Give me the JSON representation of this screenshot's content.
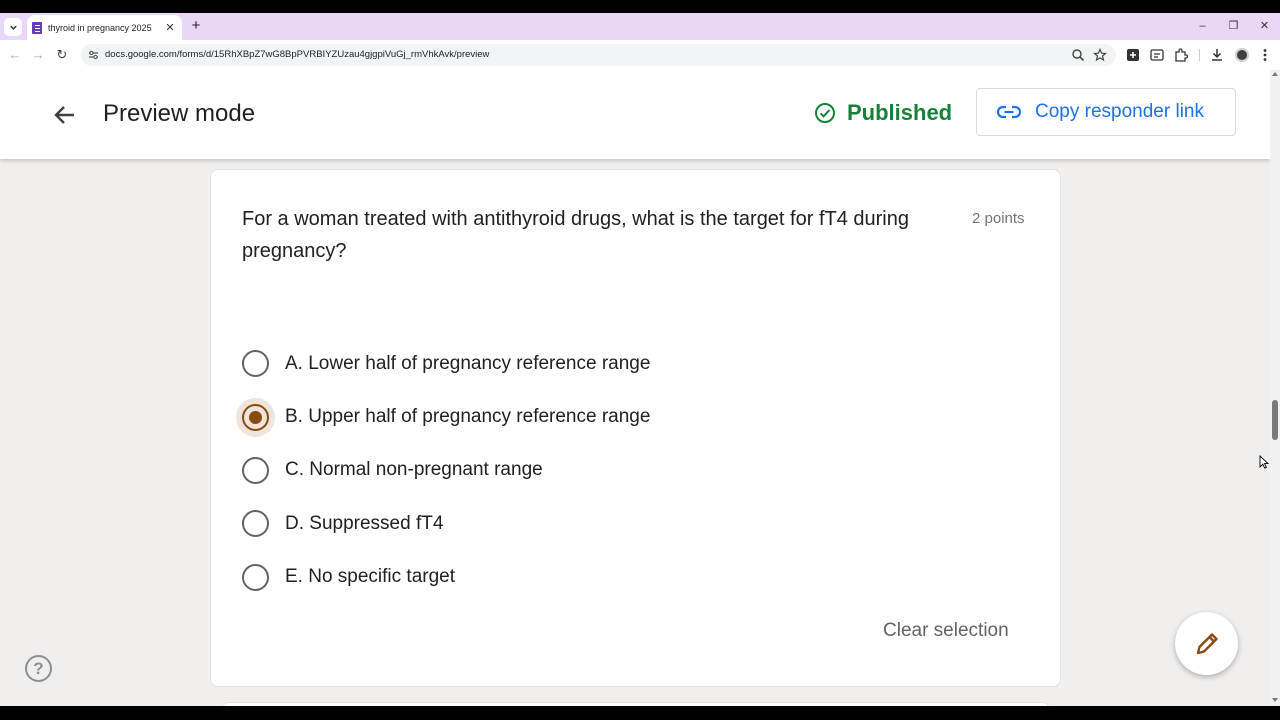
{
  "browser": {
    "tab_title": "thyroid in pregnancy 2025",
    "tab_close_glyph": "✕",
    "new_tab_glyph": "+",
    "url": "docs.google.com/forms/d/15RhXBpZ7wG8BpPVRBIYZUzau4gjgpiVuGj_rmVhkAvk/preview",
    "window_controls": [
      "–",
      "❐",
      "✕"
    ],
    "nav_glyphs": {
      "back": "←",
      "forward": "→",
      "reload": "↻"
    },
    "icons": [
      "tab-search-icon",
      "zoom-icon",
      "bookmark-star-icon",
      "extension-puzzle-icon",
      "download-icon",
      "profile-avatar-icon",
      "kebab-menu-icon"
    ]
  },
  "header": {
    "title": "Preview mode",
    "status": "Published",
    "status_color": "#188038",
    "copy_link_label": "Copy responder link",
    "accent_color": "#1a73e8"
  },
  "question": {
    "text": "For a woman treated with antithyroid drugs, what is the target for fT4 during pregnancy?",
    "points": "2 points",
    "options": [
      {
        "label": "A. Lower half of pregnancy reference range",
        "selected": false
      },
      {
        "label": "B. Upper half of pregnancy reference range",
        "selected": true
      },
      {
        "label": "C. Normal non-pregnant range",
        "selected": false
      },
      {
        "label": "D. Suppressed fT4",
        "selected": false
      },
      {
        "label": "E. No specific target",
        "selected": false
      }
    ],
    "selected_color": "#8a4b0f",
    "clear_label": "Clear selection"
  },
  "help": {
    "glyph": "?"
  }
}
